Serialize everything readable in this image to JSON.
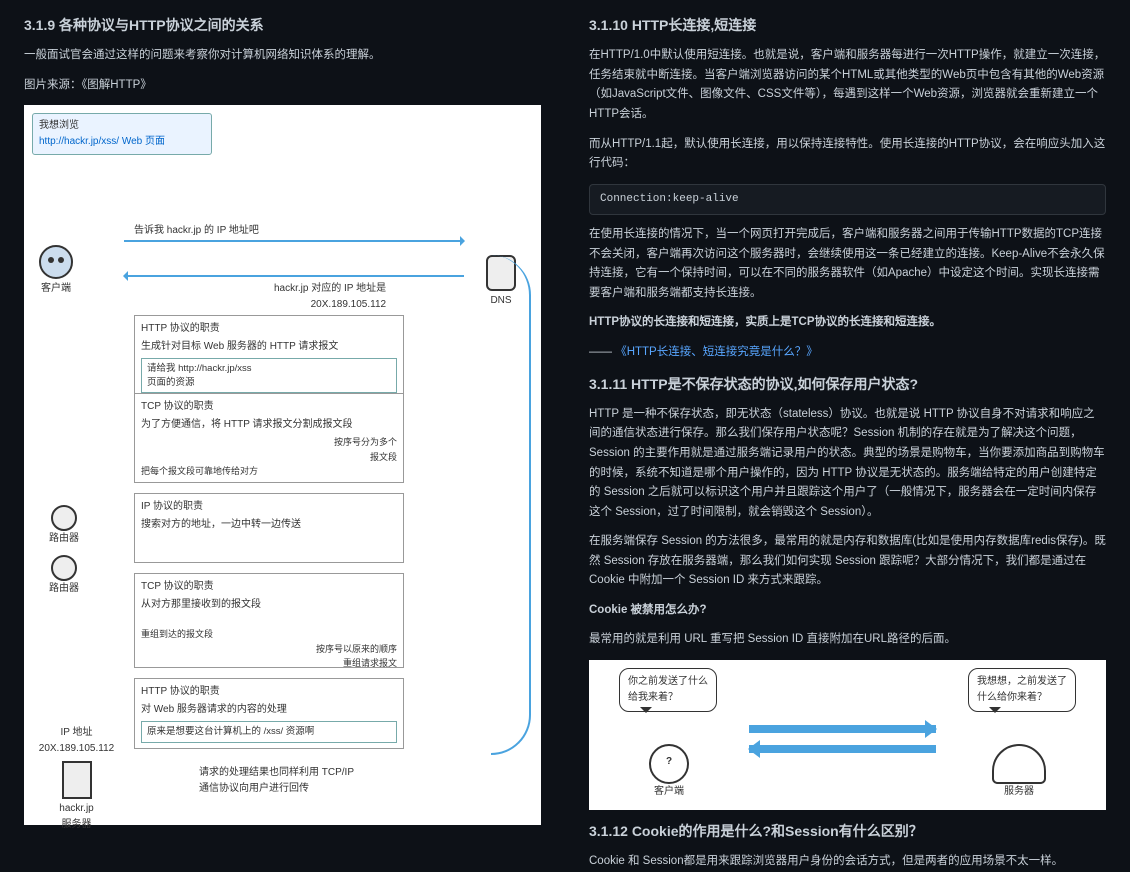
{
  "left": {
    "h319": "3.1.9 各种协议与HTTP协议之间的关系",
    "intro": "一般面试官会通过这样的问题来考察你对计算机网络知识体系的理解。",
    "source": "图片来源：《图解HTTP》",
    "diagram": {
      "bubble_l1": "我想浏览",
      "bubble_l2": "http://hackr.jp/xss/ Web 页面",
      "client": "客户端",
      "dns": "DNS",
      "req_dns": "告诉我 hackr.jp 的 IP 地址吧",
      "res_dns1": "hackr.jp 对应的 IP 地址是",
      "res_dns2": "20X.189.105.112",
      "http_box_t": "HTTP 协议的职责",
      "http_box_b": "生成针对目标 Web 服务器的 HTTP 请求报文",
      "http_sub1": "请给我 http://hackr.jp/xss",
      "http_sub2": "页面的资源",
      "tcp_box_t": "TCP 协议的职责",
      "tcp_box_b": "为了方便通信，将 HTTP 请求报文分割成报文段",
      "tcp_sub1": "按序号分为多个",
      "tcp_sub2": "报文段",
      "tcp_sub3": "把每个报文段可靠地传给对方",
      "ip_box_t": "IP 协议的职责",
      "ip_box_b": "搜索对方的地址，一边中转一边传送",
      "router": "路由器",
      "tcp2_t": "TCP 协议的职责",
      "tcp2_b": "从对方那里接收到的报文段",
      "tcp2_sub1": "重组到达的报文段",
      "tcp2_sub2": "按序号以原来的顺序",
      "tcp2_sub3": "重组请求报文",
      "http2_t": "HTTP 协议的职责",
      "http2_b": "对 Web 服务器请求的内容的处理",
      "http2_sub": "原来是想要这台计算机上的 /xss/ 资源啊",
      "ipaddr_l1": "IP 地址",
      "ipaddr_l2": "20X.189.105.112",
      "server_l1": "hackr.jp",
      "server_l2": "服务器",
      "result": "请求的处理结果也同样利用 TCP/IP",
      "result2": "通信协议向用户进行回传"
    }
  },
  "right": {
    "h3110": "3.1.10 HTTP长连接,短连接",
    "p1": "在HTTP/1.0中默认使用短连接。也就是说，客户端和服务器每进行一次HTTP操作，就建立一次连接，任务结束就中断连接。当客户端浏览器访问的某个HTML或其他类型的Web页中包含有其他的Web资源（如JavaScript文件、图像文件、CSS文件等），每遇到这样一个Web资源，浏览器就会重新建立一个HTTP会话。",
    "p2": "而从HTTP/1.1起，默认使用长连接，用以保持连接特性。使用长连接的HTTP协议，会在响应头加入这行代码：",
    "code": "Connection:keep-alive",
    "p3": "在使用长连接的情况下，当一个网页打开完成后，客户端和服务器之间用于传输HTTP数据的TCP连接不会关闭，客户端再次访问这个服务器时，会继续使用这一条已经建立的连接。Keep-Alive不会永久保持连接，它有一个保持时间，可以在不同的服务器软件（如Apache）中设定这个时间。实现长连接需要客户端和服务端都支持长连接。",
    "p4": "HTTP协议的长连接和短连接，实质上是TCP协议的长连接和短连接。",
    "p5_pre": "—— ",
    "p5_link": "《HTTP长连接、短连接究竟是什么？》",
    "h3111": "3.1.11 HTTP是不保存状态的协议,如何保存用户状态?",
    "p6": "HTTP 是一种不保存状态，即无状态（stateless）协议。也就是说 HTTP 协议自身不对请求和响应之间的通信状态进行保存。那么我们保存用户状态呢？Session 机制的存在就是为了解决这个问题，Session 的主要作用就是通过服务端记录用户的状态。典型的场景是购物车，当你要添加商品到购物车的时候，系统不知道是哪个用户操作的，因为 HTTP 协议是无状态的。服务端给特定的用户创建特定的 Session 之后就可以标识这个用户并且跟踪这个用户了（一般情况下，服务器会在一定时间内保存这个 Session，过了时间限制，就会销毁这个 Session）。",
    "p7": "在服务端保存 Session 的方法很多，最常用的就是内存和数据库(比如是使用内存数据库redis保存)。既然 Session 存放在服务器端，那么我们如何实现 Session 跟踪呢？大部分情况下，我们都是通过在 Cookie 中附加一个 Session ID 来方式来跟踪。",
    "p8": "Cookie 被禁用怎么办?",
    "p9": "最常用的就是利用 URL 重写把 Session ID 直接附加在URL路径的后面。",
    "sess": {
      "client_bubble": "你之前发送了什么\n给我来着？",
      "server_bubble": "我想想，之前发送了\n什么给你来着？",
      "client": "客户端",
      "server": "服务器"
    },
    "h3112": "3.1.12 Cookie的作用是什么?和Session有什么区别？",
    "p10": "Cookie 和 Session都是用来跟踪浏览器用户身份的会话方式，但是两者的应用场景不太一样。"
  }
}
